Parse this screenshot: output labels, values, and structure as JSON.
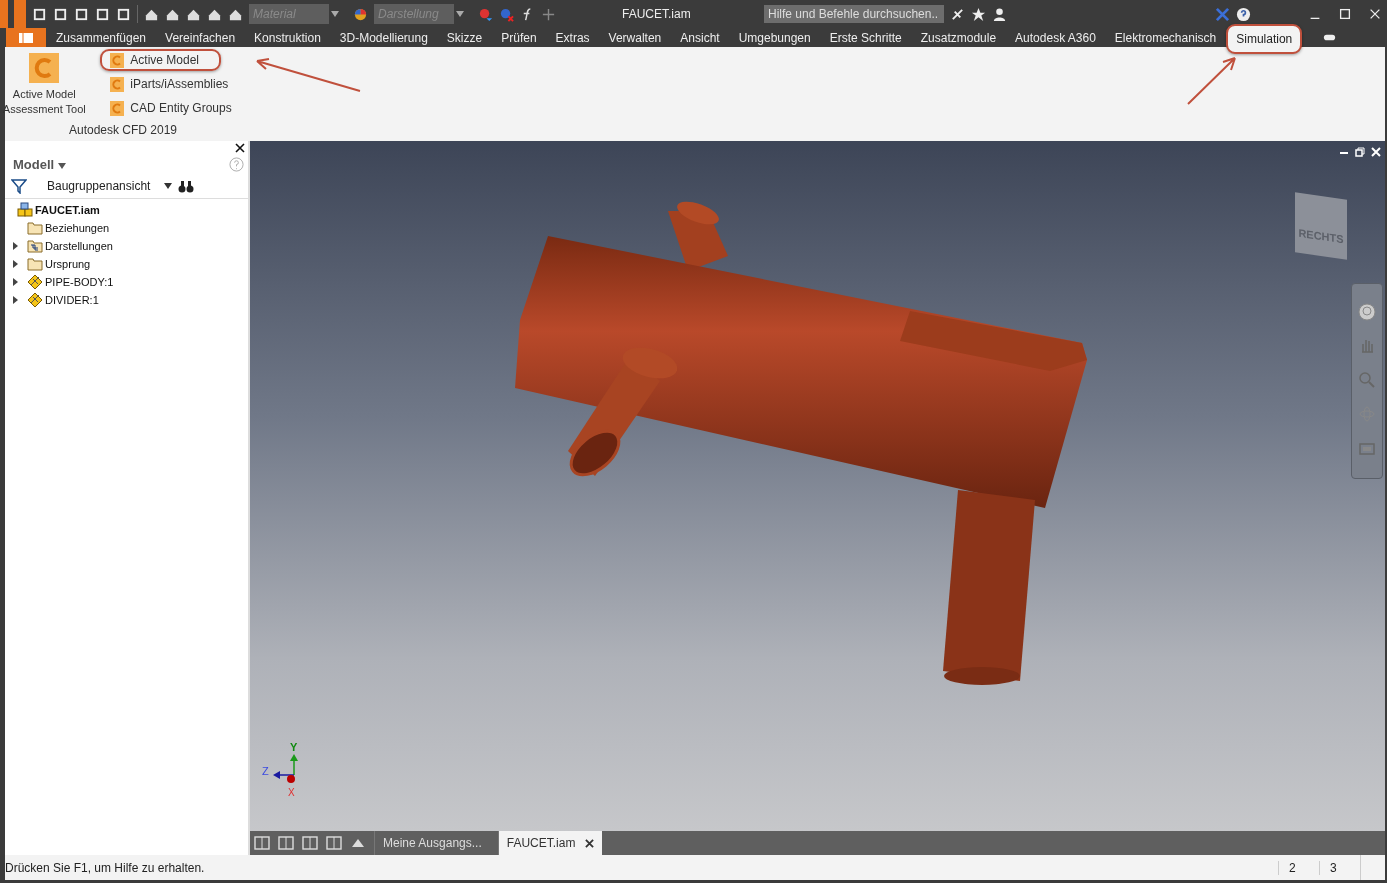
{
  "title_bar": {
    "material_placeholder": "Material",
    "appearance_placeholder": "Darstellung",
    "document_title": "FAUCET.iam",
    "search_placeholder": "Hilfe und Befehle durchsuchen.."
  },
  "ribbon_tabs": [
    {
      "label": "Zusammenfügen",
      "selected": false,
      "annotated": false
    },
    {
      "label": "Vereinfachen",
      "selected": false,
      "annotated": false
    },
    {
      "label": "Konstruktion",
      "selected": false,
      "annotated": false
    },
    {
      "label": "3D-Modellierung",
      "selected": false,
      "annotated": false
    },
    {
      "label": "Skizze",
      "selected": false,
      "annotated": false
    },
    {
      "label": "Prüfen",
      "selected": false,
      "annotated": false
    },
    {
      "label": "Extras",
      "selected": false,
      "annotated": false
    },
    {
      "label": "Verwalten",
      "selected": false,
      "annotated": false
    },
    {
      "label": "Ansicht",
      "selected": false,
      "annotated": false
    },
    {
      "label": "Umgebungen",
      "selected": false,
      "annotated": false
    },
    {
      "label": "Erste Schritte",
      "selected": false,
      "annotated": false
    },
    {
      "label": "Zusatzmodule",
      "selected": false,
      "annotated": false
    },
    {
      "label": "Autodesk A360",
      "selected": false,
      "annotated": false
    },
    {
      "label": "Elektromechanisch",
      "selected": false,
      "annotated": false
    },
    {
      "label": "Simulation",
      "selected": true,
      "annotated": true
    }
  ],
  "ribbon_panel": {
    "large_button": {
      "label": "Active Model Assessment Tool"
    },
    "small_buttons": [
      {
        "label": "Active Model",
        "annotated": true
      },
      {
        "label": "iParts/iAssemblies",
        "annotated": false
      },
      {
        "label": "CAD Entity Groups",
        "annotated": false
      }
    ],
    "title": "Autodesk CFD 2019"
  },
  "browser": {
    "title": "Modell",
    "view": "Baugruppenansicht",
    "tree": [
      {
        "label": "FAUCET.iam",
        "kind": "assembly",
        "children": [
          {
            "label": "Beziehungen",
            "kind": "folder"
          },
          {
            "label": "Darstellungen",
            "kind": "representations",
            "expanded": false
          },
          {
            "label": "Ursprung",
            "kind": "folder",
            "expanded": false
          },
          {
            "label": "PIPE-BODY:1",
            "kind": "part",
            "expanded": false
          },
          {
            "label": "DIVIDER:1",
            "kind": "part",
            "expanded": false
          }
        ]
      }
    ]
  },
  "viewport": {
    "viewcube_face": "RECHTS",
    "axes": {
      "x": "X",
      "y": "Y",
      "z": "Z"
    }
  },
  "document_tabs": [
    {
      "label": "Meine Ausgangs...",
      "selected": false
    },
    {
      "label": "FAUCET.iam",
      "selected": true
    }
  ],
  "status_bar": {
    "message": "Drücken Sie F1, um Hilfe zu erhalten.",
    "counters": [
      "2",
      "3"
    ]
  }
}
